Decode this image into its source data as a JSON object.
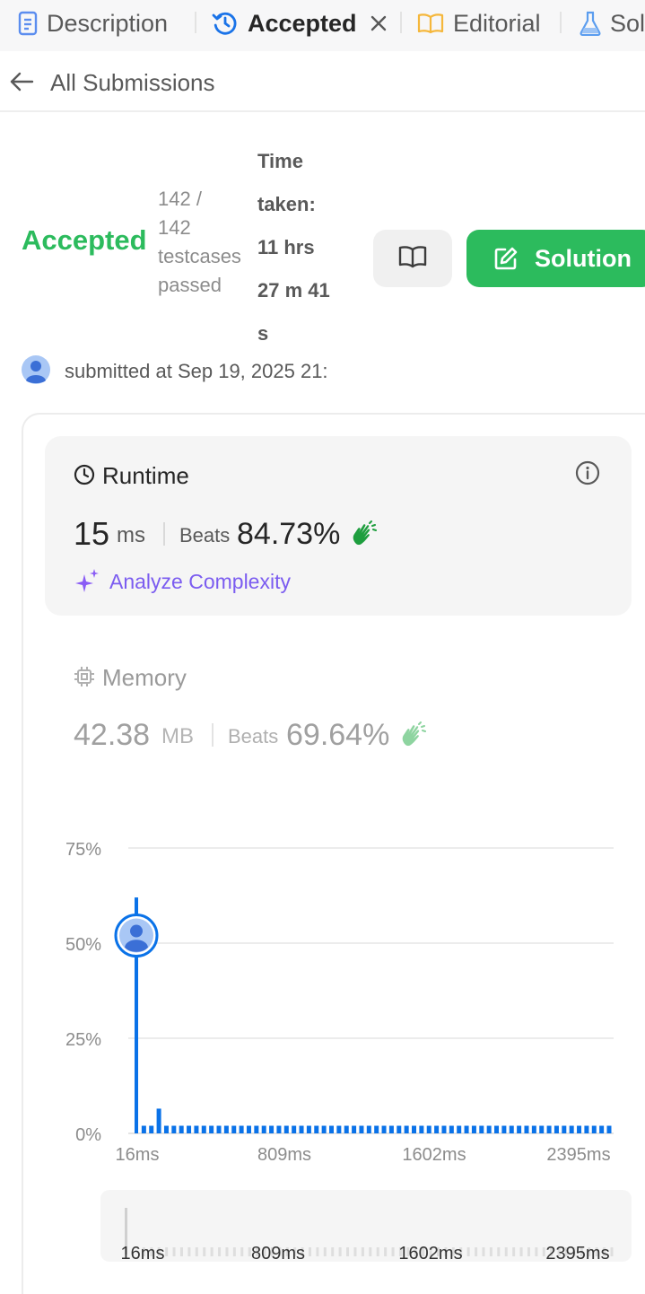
{
  "tabs": [
    {
      "label": "Description",
      "icon": "document-icon"
    },
    {
      "label": "Accepted",
      "icon": "history-icon",
      "active": true
    },
    {
      "label": "Editorial",
      "icon": "book-icon"
    },
    {
      "label": "Solutions",
      "icon": "flask-icon"
    }
  ],
  "nav": {
    "back_label": "All Submissions"
  },
  "submission": {
    "status": "Accepted",
    "testcases": [
      "142 /",
      "142",
      "testcases",
      "passed"
    ],
    "time_taken": [
      "Time",
      "taken:",
      "11 hrs",
      "27 m 41",
      "s"
    ],
    "solution_label": "Solution",
    "submitted_at": "submitted at Sep 19, 2025 21:"
  },
  "runtime": {
    "title": "Runtime",
    "value": "15",
    "unit": "ms",
    "beats_label": "Beats",
    "beats_value": "84.73%",
    "analyze_label": "Analyze Complexity"
  },
  "memory": {
    "title": "Memory",
    "value": "42.38",
    "unit": "MB",
    "beats_label": "Beats",
    "beats_value": "69.64%"
  },
  "colors": {
    "accent_green": "#2cbb5d",
    "bar_blue": "#0a72e8",
    "analyze_purple": "#7b5cf0"
  },
  "chart_data": {
    "type": "bar",
    "y_ticks": [
      "75%",
      "50%",
      "25%",
      "0%"
    ],
    "ylim": [
      0,
      75
    ],
    "x_tick_labels": [
      "16ms",
      "809ms",
      "1602ms",
      "2395ms"
    ],
    "bins": 64,
    "values": [
      62,
      2,
      2,
      6.5,
      2,
      2,
      2,
      2,
      2,
      2,
      2,
      2,
      2,
      2,
      2,
      2,
      2,
      2,
      2,
      2,
      2,
      2,
      2,
      2,
      2,
      2,
      2,
      2,
      2,
      2,
      2,
      2,
      2,
      2,
      2,
      2,
      2,
      2,
      2,
      2,
      2,
      2,
      2,
      2,
      2,
      2,
      2,
      2,
      2,
      2,
      2,
      2,
      2,
      2,
      2,
      2,
      2,
      2,
      2,
      2,
      2,
      2,
      2,
      2
    ],
    "user_marker_value": 52,
    "mini_x_tick_labels": [
      "16ms",
      "809ms",
      "1602ms",
      "2395ms"
    ]
  }
}
